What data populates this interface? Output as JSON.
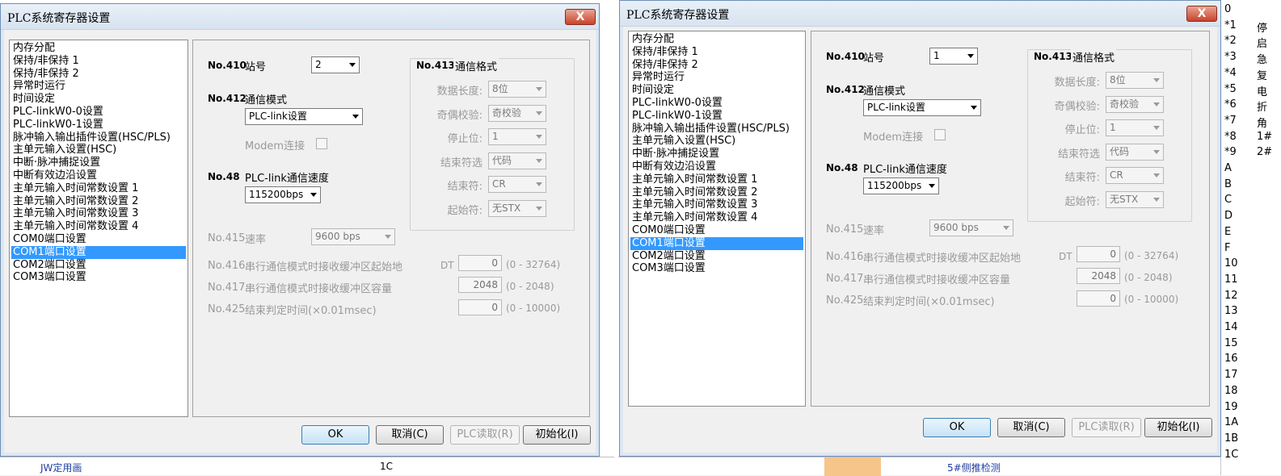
{
  "dialogs": [
    {
      "title": "PLC系统寄存器设置",
      "close_label": "X",
      "nav_items": [
        "内存分配",
        "保持/非保持 1",
        "保持/非保持 2",
        "异常时运行",
        "时间设定",
        "PLC-linkW0-0设置",
        "PLC-linkW0-1设置",
        "脉冲输入输出插件设置(HSC/PLS)",
        "主单元输入设置(HSC)",
        "中断·脉冲捕捉设置",
        "中断有效边沿设置",
        "主单元输入时间常数设置 1",
        "主单元输入时间常数设置 2",
        "主单元输入时间常数设置 3",
        "主单元输入时间常数设置 4",
        "COM0端口设置",
        "COM1端口设置",
        "COM2端口设置",
        "COM3端口设置"
      ],
      "selected_index": 16,
      "no410": "No.410",
      "station_label": "站号",
      "station_value": "2",
      "no412": "No.412",
      "mode_label": "通信模式",
      "mode_value": "PLC-link设置",
      "modem_label": "Modem连接",
      "no48": "No.48",
      "speed_label": "PLC-link通信速度",
      "speed_value": "115200bps",
      "no413": "No.413",
      "format_label": "通信格式",
      "format_rows": [
        {
          "label": "数据长度:",
          "value": "8位"
        },
        {
          "label": "奇偶校验:",
          "value": "奇校验"
        },
        {
          "label": "停止位:",
          "value": "1"
        },
        {
          "label": "结束符选",
          "value": "代码"
        },
        {
          "label": "结束符:",
          "value": "CR"
        },
        {
          "label": "起始符:",
          "value": "无STX"
        }
      ],
      "no415": "No.415",
      "rate_label": "速率",
      "rate_value": "9600 bps",
      "no416": "No.416",
      "buf_start_label": "串行通信模式时接收缓冲区起始地",
      "dt_label": "DT",
      "buf_start_value": "0",
      "buf_start_range": "(0 - 32764)",
      "no417": "No.417",
      "buf_cap_label": "串行通信模式时接收缓冲区容量",
      "buf_cap_value": "2048",
      "buf_cap_range": "(0 - 2048)",
      "no425": "No.425",
      "end_time_label": "结束判定时间(×0.01msec)",
      "end_time_value": "0",
      "end_time_range": "(0 - 10000)",
      "ok_label": "OK",
      "cancel_label": "取消(C)",
      "plc_read_label": "PLC读取(R)",
      "init_label": "初始化(I)"
    },
    {
      "title": "PLC系统寄存器设置",
      "close_label": "X",
      "nav_items": [
        "内存分配",
        "保持/非保持 1",
        "保持/非保持 2",
        "异常时运行",
        "时间设定",
        "PLC-linkW0-0设置",
        "PLC-linkW0-1设置",
        "脉冲输入输出插件设置(HSC/PLS)",
        "主单元输入设置(HSC)",
        "中断·脉冲捕捉设置",
        "中断有效边沿设置",
        "主单元输入时间常数设置 1",
        "主单元输入时间常数设置 2",
        "主单元输入时间常数设置 3",
        "主单元输入时间常数设置 4",
        "COM0端口设置",
        "COM1端口设置",
        "COM2端口设置",
        "COM3端口设置"
      ],
      "selected_index": 16,
      "no410": "No.410",
      "station_label": "站号",
      "station_value": "1",
      "no412": "No.412",
      "mode_label": "通信模式",
      "mode_value": "PLC-link设置",
      "modem_label": "Modem连接",
      "no48": "No.48",
      "speed_label": "PLC-link通信速度",
      "speed_value": "115200bps",
      "no413": "No.413",
      "format_label": "通信格式",
      "format_rows": [
        {
          "label": "数据长度:",
          "value": "8位"
        },
        {
          "label": "奇偶校验:",
          "value": "奇校验"
        },
        {
          "label": "停止位:",
          "value": "1"
        },
        {
          "label": "结束符选",
          "value": "代码"
        },
        {
          "label": "结束符:",
          "value": "CR"
        },
        {
          "label": "起始符:",
          "value": "无STX"
        }
      ],
      "no415": "No.415",
      "rate_label": "速率",
      "rate_value": "9600 bps",
      "no416": "No.416",
      "buf_start_label": "串行通信模式时接收缓冲区起始地",
      "dt_label": "DT",
      "buf_start_value": "0",
      "buf_start_range": "(0 - 32764)",
      "no417": "No.417",
      "buf_cap_label": "串行通信模式时接收缓冲区容量",
      "buf_cap_value": "2048",
      "buf_cap_range": "(0 - 2048)",
      "no425": "No.425",
      "end_time_label": "结束判定时间(×0.01msec)",
      "end_time_value": "0",
      "end_time_range": "(0 - 10000)",
      "ok_label": "OK",
      "cancel_label": "取消(C)",
      "plc_read_label": "PLC读取(R)",
      "init_label": "初始化(I)"
    }
  ],
  "right_column": [
    {
      "n": "0",
      "c": ""
    },
    {
      "n": "*1",
      "c": "停"
    },
    {
      "n": "*2",
      "c": "启"
    },
    {
      "n": "*3",
      "c": "急"
    },
    {
      "n": "*4",
      "c": "复"
    },
    {
      "n": "*5",
      "c": "电"
    },
    {
      "n": "*6",
      "c": "折"
    },
    {
      "n": "*7",
      "c": "角"
    },
    {
      "n": "*8",
      "c": "1#"
    },
    {
      "n": "*9",
      "c": "2#"
    },
    {
      "n": "A",
      "c": ""
    },
    {
      "n": "B",
      "c": ""
    },
    {
      "n": "C",
      "c": ""
    },
    {
      "n": "D",
      "c": ""
    },
    {
      "n": "E",
      "c": ""
    },
    {
      "n": "F",
      "c": ""
    },
    {
      "n": "10",
      "c": ""
    },
    {
      "n": "11",
      "c": ""
    },
    {
      "n": "12",
      "c": ""
    },
    {
      "n": "13",
      "c": ""
    },
    {
      "n": "14",
      "c": ""
    },
    {
      "n": "15",
      "c": ""
    },
    {
      "n": "16",
      "c": ""
    },
    {
      "n": "17",
      "c": ""
    },
    {
      "n": "18",
      "c": ""
    },
    {
      "n": "19",
      "c": ""
    },
    {
      "n": "1A",
      "c": ""
    },
    {
      "n": "1B",
      "c": ""
    },
    {
      "n": "1C",
      "c": ""
    }
  ],
  "background": {
    "bottom_left_text": "JW定用画",
    "bottom_mid_text": "1C",
    "bottom_right_text": "5#侧推检测"
  }
}
